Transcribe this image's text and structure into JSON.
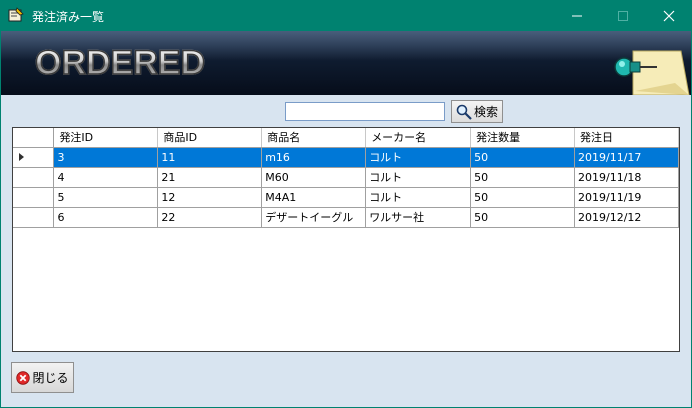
{
  "window": {
    "title": "発注済み一覧",
    "min_glyph": "—",
    "max_glyph": "☐",
    "close_glyph": "✕"
  },
  "banner": {
    "logo_text": "ORDERED",
    "pin_icon": "note-pin-icon"
  },
  "search": {
    "value": "",
    "button_label": "検索",
    "button_icon": "magnifier-icon"
  },
  "grid": {
    "columns": [
      "発注ID",
      "商品ID",
      "商品名",
      "メーカー名",
      "発注数量",
      "発注日"
    ],
    "rows": [
      [
        "3",
        "11",
        "m16",
        "コルト",
        "50",
        "2019/11/17"
      ],
      [
        "4",
        "21",
        "M60",
        "コルト",
        "50",
        "2019/11/18"
      ],
      [
        "5",
        "12",
        "M4A1",
        "コルト",
        "50",
        "2019/11/19"
      ],
      [
        "6",
        "22",
        "デザートイーグル",
        "ワルサー社",
        "50",
        "2019/12/12"
      ]
    ],
    "selected_row": 0
  },
  "footer": {
    "close_label": "閉じる",
    "close_icon": "red-x-icon"
  },
  "colors": {
    "titlebar": "#008270",
    "selection": "#0078d7",
    "client_bg": "#d8e4f0"
  }
}
